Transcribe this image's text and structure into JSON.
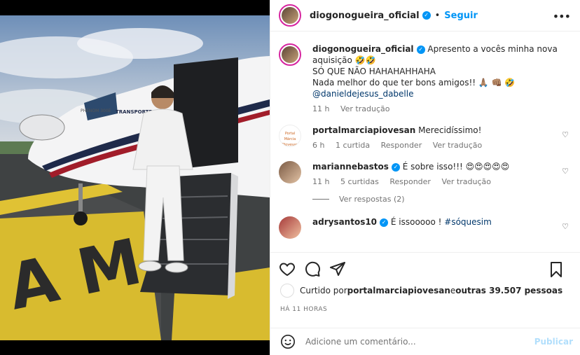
{
  "post": {
    "username": "diogonogueira_oficial",
    "follow_label": "Seguir",
    "dot": "•",
    "more_label": "•••"
  },
  "caption": {
    "username": "diogonogueira_oficial",
    "line1": "Apresento a vocês minha nova aquisição 🤣🤣",
    "line2": "SÓ QUE NÃO HAHAHAHHAHA",
    "line3": "Nada melhor do que ter bons amigos!! 🙏🏽 👊🏽 🤣",
    "mention": "@danieldejesus_dabelle",
    "time": "11 h",
    "translate": "Ver tradução"
  },
  "comments": [
    {
      "username": "portalmarciapiovesan",
      "text": "Merecidíssimo!",
      "time": "6 h",
      "likes": "1 curtida",
      "reply": "Responder",
      "translate": "Ver tradução",
      "avatar_text": "Portal Márcia Piovesan",
      "verified": false
    },
    {
      "username": "mariannebastos",
      "text": "É sobre isso!!! 😍😍😍😍😍",
      "time": "11 h",
      "likes": "5 curtidas",
      "reply": "Responder",
      "translate": "Ver tradução",
      "verified": true
    },
    {
      "username": "adrysantos10",
      "text": "É issooooo ! ",
      "hashtag": "#sóquesim",
      "verified": true
    }
  ],
  "replies_label": "Ver respostas (2)",
  "likes_text": {
    "prefix": "Curtido por ",
    "user": "portalmarciapiovesan",
    "middle": " e ",
    "others": "outras 39.507 pessoas"
  },
  "timestamp": "HÁ 11 HORAS",
  "comment_box": {
    "placeholder": "Adicione um comentário...",
    "publish": "Publicar"
  },
  "photo": {
    "jet_model": "PHENOM 300E",
    "jet_text": "TRANSPORTE P",
    "tarmac_letters": "A M B"
  },
  "colors": {
    "accent": "#0095f6",
    "publish_disabled": "#b2dffc",
    "mention": "#00376b"
  },
  "icons": [
    "verified-icon",
    "more-icon",
    "heart-icon",
    "comment-icon",
    "share-icon",
    "save-icon",
    "emoji-icon"
  ]
}
